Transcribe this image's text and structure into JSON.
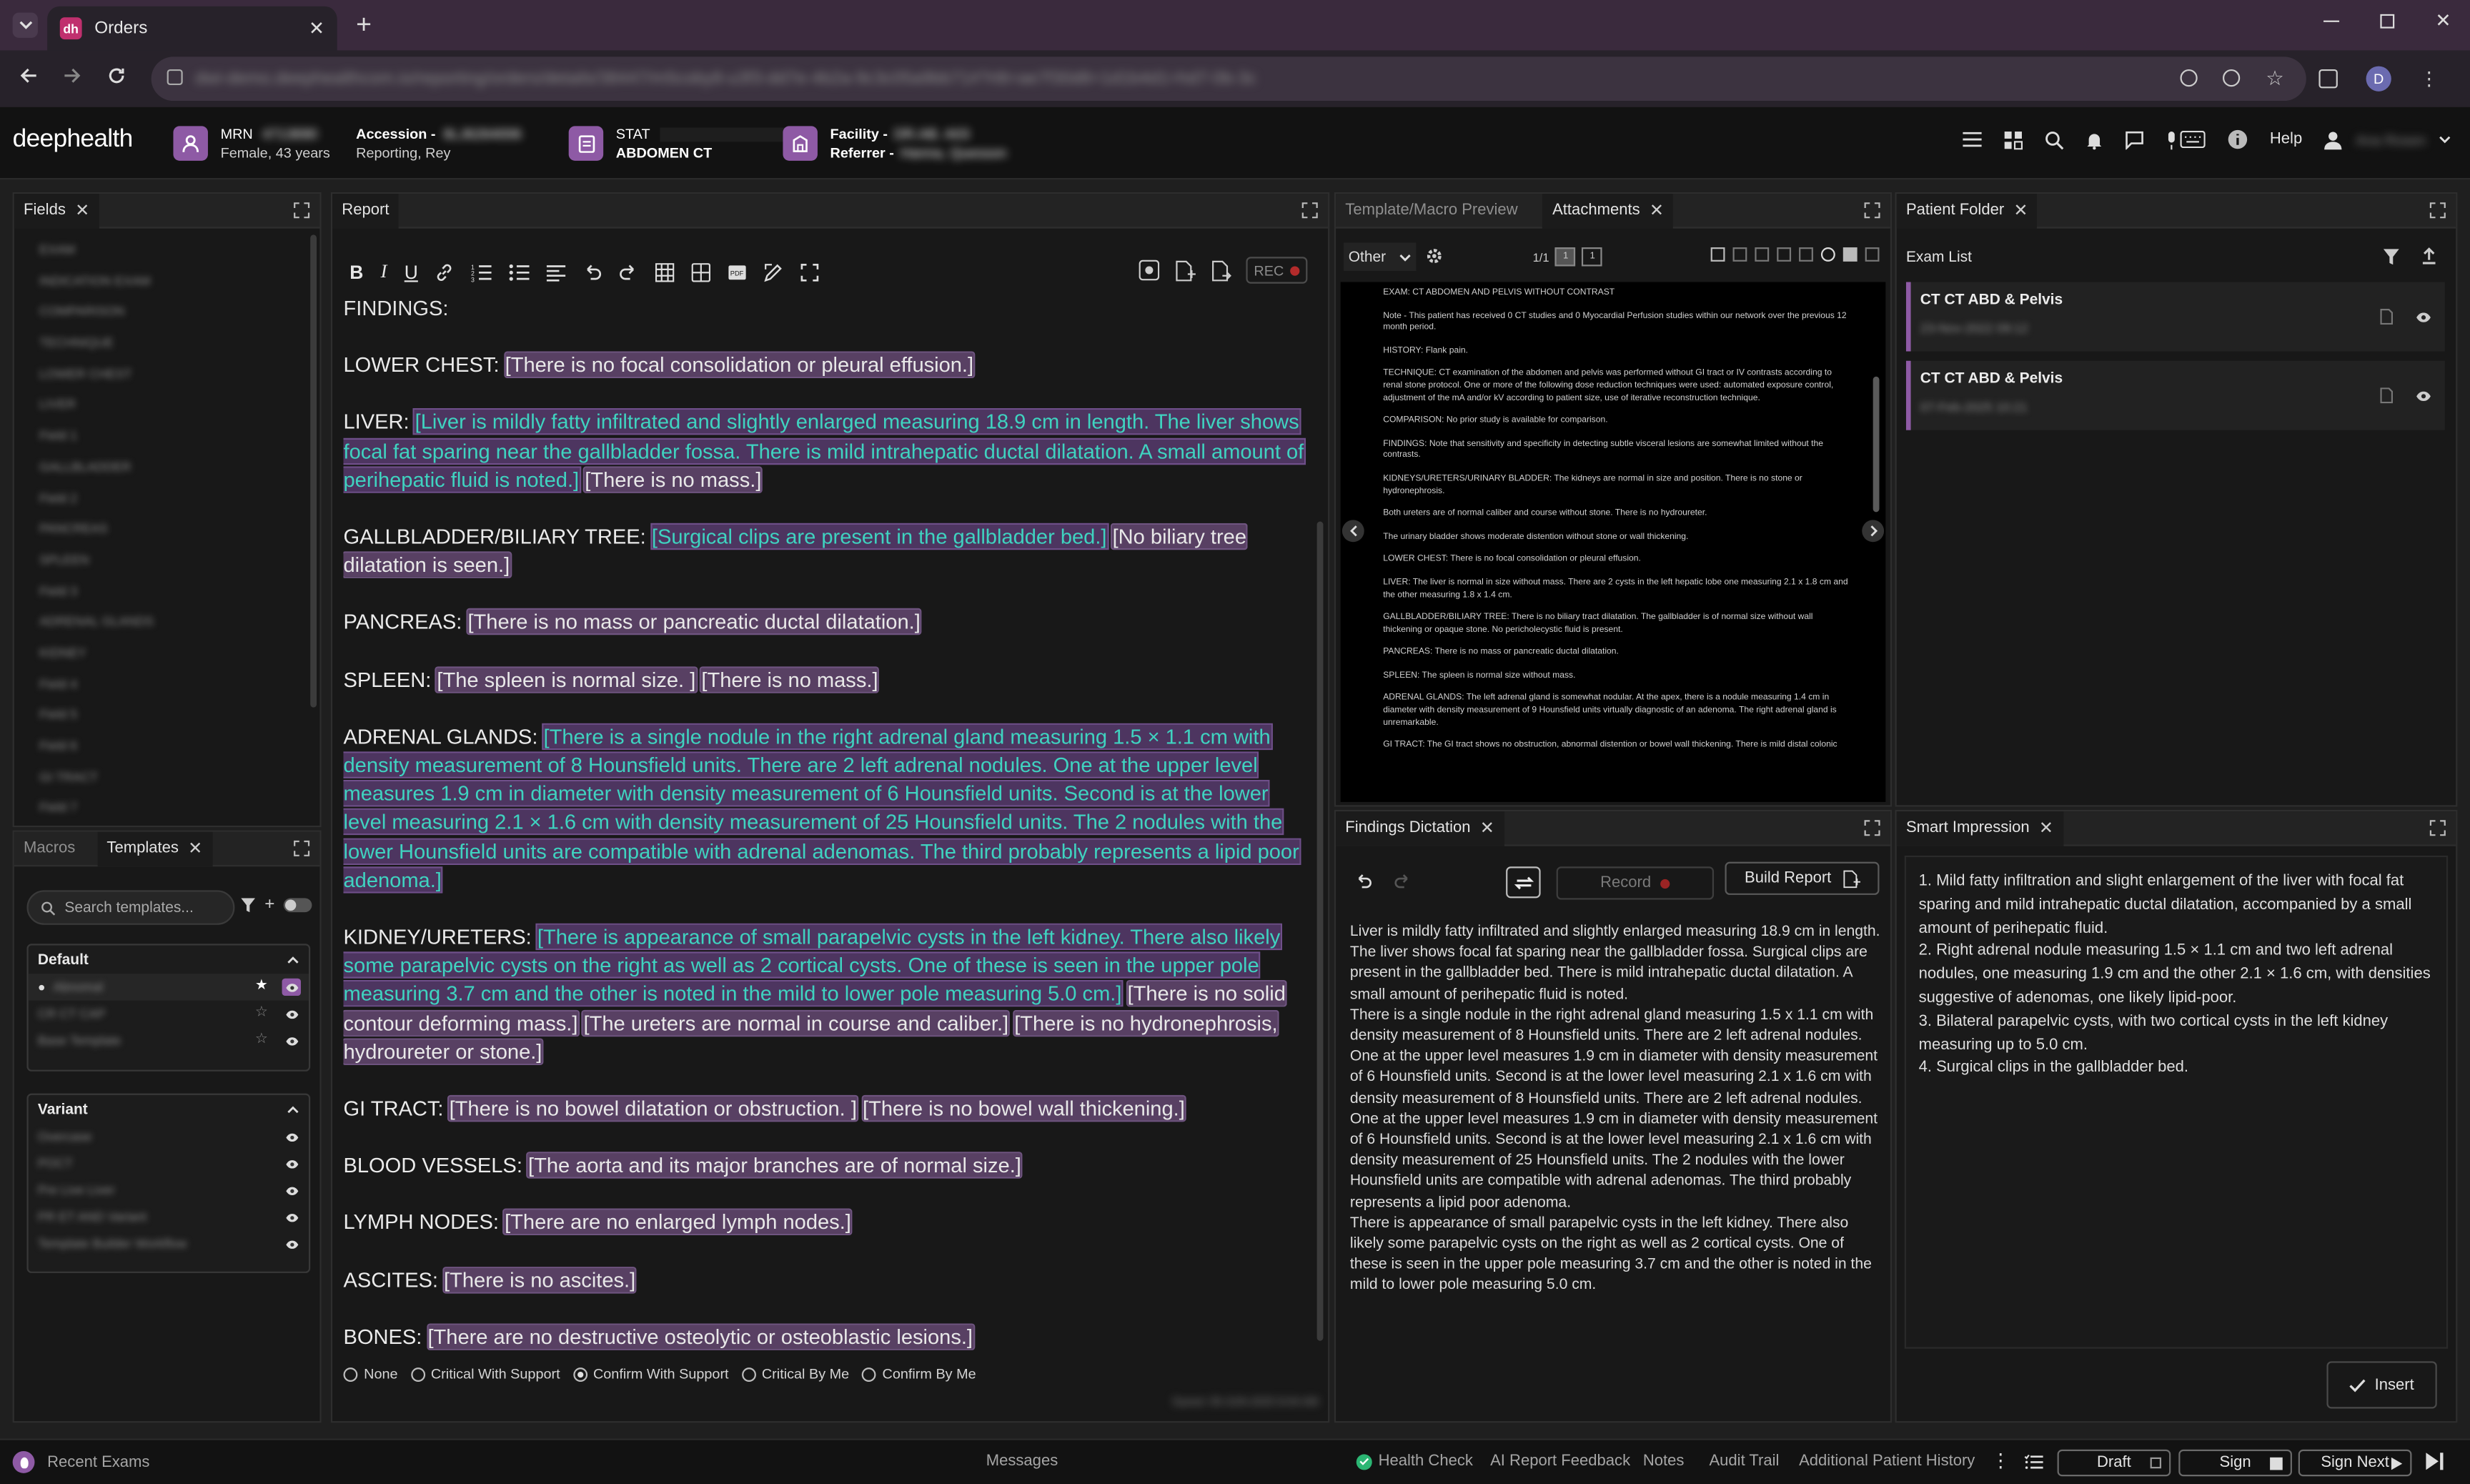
{
  "browser": {
    "tab_title": "Orders",
    "tab_favicon": "dh",
    "new_tab": "+",
    "url": "dwi-demo.deephealthcom.io/reporting/orders/details/38447/m5coby8-u3f3-dd7e-4b2a-9c3c05a9bb71#?rtlt=ae7f30d8=1d1b4d1=hd7-0b-3c"
  },
  "header": {
    "logo": "deephealth",
    "mrn_label": "MRN",
    "mrn_value": "4713690",
    "patient_info": "Female, 43 years",
    "accession_label": "Accession -",
    "accession_value": "8LJ6264006",
    "reporting": "Reporting, Rey",
    "priority": "STAT",
    "exam": "ABDOMEN CT",
    "facility_label": "Facility -",
    "facility_value": "DR.AB. A03",
    "referrer_label": "Referrer -",
    "referrer_value": "Hanna, Quesson",
    "help": "Help",
    "user": "Ana Rosen",
    "accent": "#8e5aa5"
  },
  "fields_panel": {
    "title": "Fields",
    "items": [
      "EXAM",
      "INDICATION EXAM",
      "COMPARISON",
      "TECHNIQUE",
      "LOWER CHEST",
      "LIVER",
      "Field 1",
      "GALLBLADDER",
      "Field 2",
      "PANCREAS",
      "SPLEEN",
      "Field 3",
      "ADRENAL GLANDS",
      "KIDNEY",
      "Field 4",
      "Field 5",
      "Field 6",
      "GI TRACT",
      "Field 7"
    ]
  },
  "templates_panel": {
    "tabs": [
      "Macros",
      "Templates"
    ],
    "search_placeholder": "Search templates...",
    "default_title": "Default",
    "default_items": [
      "Abnomal",
      "CR CT CAP",
      "Base Template"
    ],
    "variant_title": "Variant",
    "variant_items": [
      "Overcase",
      "POCT",
      "Pre Live Liver",
      "PR ET AND Variant",
      "Template Builder Workflow"
    ]
  },
  "report_panel": {
    "title": "Report",
    "rec_label": "REC",
    "findings_heading": "FINDINGS:",
    "sections": [
      {
        "label": "LOWER CHEST:",
        "parts": [
          {
            "t": "[There is no focal consolidation or pleural effusion.]",
            "k": "hl"
          }
        ]
      },
      {
        "label": "LIVER:",
        "parts": [
          {
            "t": "[Liver is mildly fatty infiltrated and slightly enlarged measuring 18.9 cm in length. The liver shows focal fat sparing near the gallbladder fossa. There is mild intrahepatic ductal dilatation. A small amount of perihepatic fluid is noted.]",
            "k": "tl"
          },
          {
            "t": "[There is no mass.]",
            "k": "hl"
          }
        ]
      },
      {
        "label": "GALLBLADDER/BILIARY TREE:",
        "parts": [
          {
            "t": "[Surgical clips are present in the gallbladder bed.]",
            "k": "tl"
          },
          {
            "t": "[No biliary tree dilatation is seen.]",
            "k": "hl"
          }
        ]
      },
      {
        "label": "PANCREAS:",
        "parts": [
          {
            "t": "[There is no mass or pancreatic ductal dilatation.]",
            "k": "hl"
          }
        ]
      },
      {
        "label": "SPLEEN:",
        "parts": [
          {
            "t": "[The spleen is normal size. ]",
            "k": "hl"
          },
          {
            "t": "[There is no mass.]",
            "k": "hl"
          }
        ]
      },
      {
        "label": "ADRENAL GLANDS:",
        "parts": [
          {
            "t": "[There is a single nodule in the right adrenal gland measuring 1.5 × 1.1 cm with density measurement of 8 Hounsfield units. There are 2 left adrenal nodules. One at the upper level measures 1.9 cm in diameter with density measurement of 6 Hounsfield units. Second is at the lower level measuring 2.1 × 1.6 cm with density measurement of 25 Hounsfield units. The 2 nodules with the lower Hounsfield units are compatible with adrenal adenomas. The third probably represents a lipid poor adenoma.]",
            "k": "tl"
          }
        ]
      },
      {
        "label": "KIDNEY/URETERS:",
        "parts": [
          {
            "t": "[There is appearance of small parapelvic cysts in the left kidney. There also likely some parapelvic cysts on the right as well as 2 cortical cysts. One of these is seen in the upper pole measuring 3.7 cm and the other is noted in the mild to lower pole measuring 5.0 cm.]",
            "k": "tl"
          },
          {
            "t": "[There is no solid contour deforming mass.]",
            "k": "hl"
          },
          {
            "t": "[The ureters are normal in course and caliber.]",
            "k": "hl"
          },
          {
            "t": "[There is no hydronephrosis, hydroureter or stone.]",
            "k": "hl"
          }
        ]
      },
      {
        "label": "GI TRACT:",
        "parts": [
          {
            "t": "[There is no bowel dilatation or obstruction. ]",
            "k": "hl"
          },
          {
            "t": "[There is no bowel wall thickening.]",
            "k": "hl"
          }
        ]
      },
      {
        "label": "BLOOD VESSELS:",
        "parts": [
          {
            "t": "[The aorta and its major branches are of normal size.]",
            "k": "hl"
          }
        ]
      },
      {
        "label": "LYMPH NODES:",
        "parts": [
          {
            "t": "[There are no enlarged lymph nodes.]",
            "k": "hl"
          }
        ]
      },
      {
        "label": "ASCITES:",
        "parts": [
          {
            "t": "[There is no ascites.]",
            "k": "hl"
          }
        ]
      },
      {
        "label": "BONES:",
        "parts": [
          {
            "t": "[There are no destructive osteolytic or osteoblastic lesions.]",
            "k": "hl"
          }
        ]
      }
    ],
    "radios": [
      "None",
      "Critical With Support",
      "Confirm With Support",
      "Critical By Me",
      "Confirm By Me"
    ],
    "saved_text": "Saved: 09-JUN-2025 8:04 AM"
  },
  "preview_panel": {
    "tabs": [
      "Template/Macro Preview",
      "Attachments"
    ],
    "category": "Other",
    "page_count": "1/1",
    "page_a": "1",
    "page_b": "1",
    "doc_lines": [
      "EXAM: CT ABDOMEN AND PELVIS WITHOUT CONTRAST",
      "Note - This patient has received 0 CT studies and 0 Myocardial Perfusion studies within our network over the previous 12 month period.",
      "HISTORY: Flank pain.",
      "TECHNIQUE: CT examination of the abdomen and pelvis was performed without GI tract or IV contrasts according to renal stone protocol. One or more of the following dose reduction techniques were used: automated exposure control, adjustment of the mA and/or kV according to patient size, use of iterative reconstruction technique.",
      "COMPARISON: No prior study is available for comparison.",
      "FINDINGS: Note that sensitivity and specificity in detecting subtle visceral lesions are somewhat limited without the contrasts.",
      "KIDNEYS/URETERS/URINARY BLADDER: The kidneys are normal in size and position. There is no stone or hydronephrosis.",
      "Both ureters are of normal caliber and course without stone. There is no hydroureter.",
      "The urinary bladder shows moderate distention without stone or wall thickening.",
      "LOWER CHEST: There is no focal consolidation or pleural effusion.",
      "LIVER: The liver is normal in size without mass. There are 2 cysts in the left hepatic lobe one measuring 2.1 x 1.8 cm and the other measuring 1.8 x 1.4 cm.",
      "GALLBLADDER/BILIARY TREE: There is no biliary tract dilatation. The gallbladder is of normal size without wall thickening or opaque stone. No pericholecystic fluid is present.",
      "PANCREAS: There is no mass or pancreatic ductal dilatation.",
      "SPLEEN: The spleen is normal size without mass.",
      "ADRENAL GLANDS: The left adrenal gland is somewhat nodular. At the apex, there is a nodule measuring 1.4 cm in diameter with density measurement of 9 Hounsfield units virtually diagnostic of an adenoma. The right adrenal gland is unremarkable.",
      "GI TRACT: The GI tract shows no obstruction, abnormal distention or bowel wall thickening. There is mild distal colonic"
    ]
  },
  "patient_folder": {
    "title": "Patient Folder",
    "exam_list_label": "Exam List",
    "exams": [
      {
        "name": "CT CT ABD & Pelvis",
        "date": "23-Nov-2022 09:12"
      },
      {
        "name": "CT CT ABD & Pelvis",
        "date": "07-Feb-2025 10:21"
      }
    ]
  },
  "findings_dictation": {
    "title": "Findings Dictation",
    "record_label": "Record",
    "build_report_label": "Build Report",
    "text": "Liver is mildly fatty infiltrated and slightly enlarged measuring 18.9 cm in length. The liver shows focal fat sparing near the gallbladder fossa. Surgical clips are present in the gallbladder bed. There is mild intrahepatic ductal dilatation. A small amount of perihepatic fluid is noted.\nThere is a single nodule in the right adrenal gland measuring 1.5 x 1.1 cm with density measurement of 8 Hounsfield units. There are 2 left adrenal nodules. One at the upper level measures 1.9 cm in diameter with density measurement of 6 Hounsfield units. Second is at the lower level measuring 2.1 x 1.6 cm with density measurement of 8 Hounsfield units. There are 2 left adrenal nodules. One at the upper level measures 1.9 cm in diameter with density measurement of 6 Hounsfield units. Second is at the lower level measuring 2.1 x 1.6 cm with density measurement of 25 Hounsfield units. The 2 nodules with the lower Hounsfield units are compatible with adrenal adenomas. The third probably represents a lipid poor adenoma.\nThere is appearance of small parapelvic cysts in the left kidney. There also likely some parapelvic cysts on the right as well as 2 cortical cysts. One of these is seen in the upper pole measuring 3.7 cm and the other is noted in the mild to lower pole measuring 5.0 cm."
  },
  "smart_impression": {
    "title": "Smart Impression",
    "text": "1. Mild fatty infiltration and slight enlargement of the liver with focal fat sparing and mild intrahepatic ductal dilatation, accompanied by a small amount of perihepatic fluid.\n2. Right adrenal nodule measuring 1.5 × 1.1 cm and two left adrenal nodules, one measuring 1.9 cm and the other 2.1 × 1.6 cm, with densities suggestive of adenomas, one likely lipid-poor.\n3. Bilateral parapelvic cysts, with two cortical cysts in the left kidney measuring up to 5.0 cm.\n4. Surgical clips in the gallbladder bed.",
    "insert_label": "Insert"
  },
  "footer": {
    "recent_exams": "Recent Exams",
    "messages": "Messages",
    "health_check": "Health Check",
    "ai_feedback": "AI Report Feedback",
    "notes": "Notes",
    "audit_trail": "Audit Trail",
    "additional_history": "Additional Patient History",
    "draft": "Draft",
    "sign": "Sign",
    "sign_next": "Sign Next"
  },
  "colors": {
    "teal_text": "#3fd3c0",
    "highlight": "#584063",
    "accent": "#8e5aa5",
    "health_ok": "#2bb673"
  }
}
